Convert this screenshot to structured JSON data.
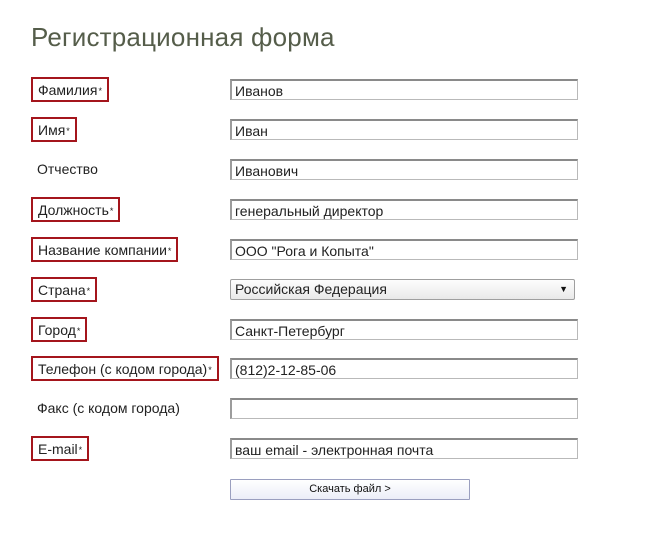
{
  "page": {
    "title": "Регистрационная форма"
  },
  "form": {
    "required_mark": "*",
    "fields": [
      {
        "label": "Фамилия",
        "value": "Иванов"
      },
      {
        "label": "Имя",
        "value": "Иван"
      },
      {
        "label": "Отчество",
        "value": "Иванович"
      },
      {
        "label": "Должность",
        "value": "генеральный директор"
      },
      {
        "label": "Название компании",
        "value": "ООО \"Рога и Копыта\""
      },
      {
        "label": "Страна",
        "value": "Российская Федерация"
      },
      {
        "label": "Город",
        "value": "Санкт-Петербург"
      },
      {
        "label": "Телефон (с кодом города)",
        "value": "(812)2-12-85-06"
      },
      {
        "label": "Факс (с кодом города)",
        "value": ""
      },
      {
        "label": "E-mail",
        "value": "ваш email - электронная почта"
      }
    ],
    "submit_label": "Скачать файл >"
  },
  "colors": {
    "required_border": "#a4151c",
    "title": "#555d4a"
  },
  "icons": {
    "select_arrow": "triangle-down-icon"
  }
}
